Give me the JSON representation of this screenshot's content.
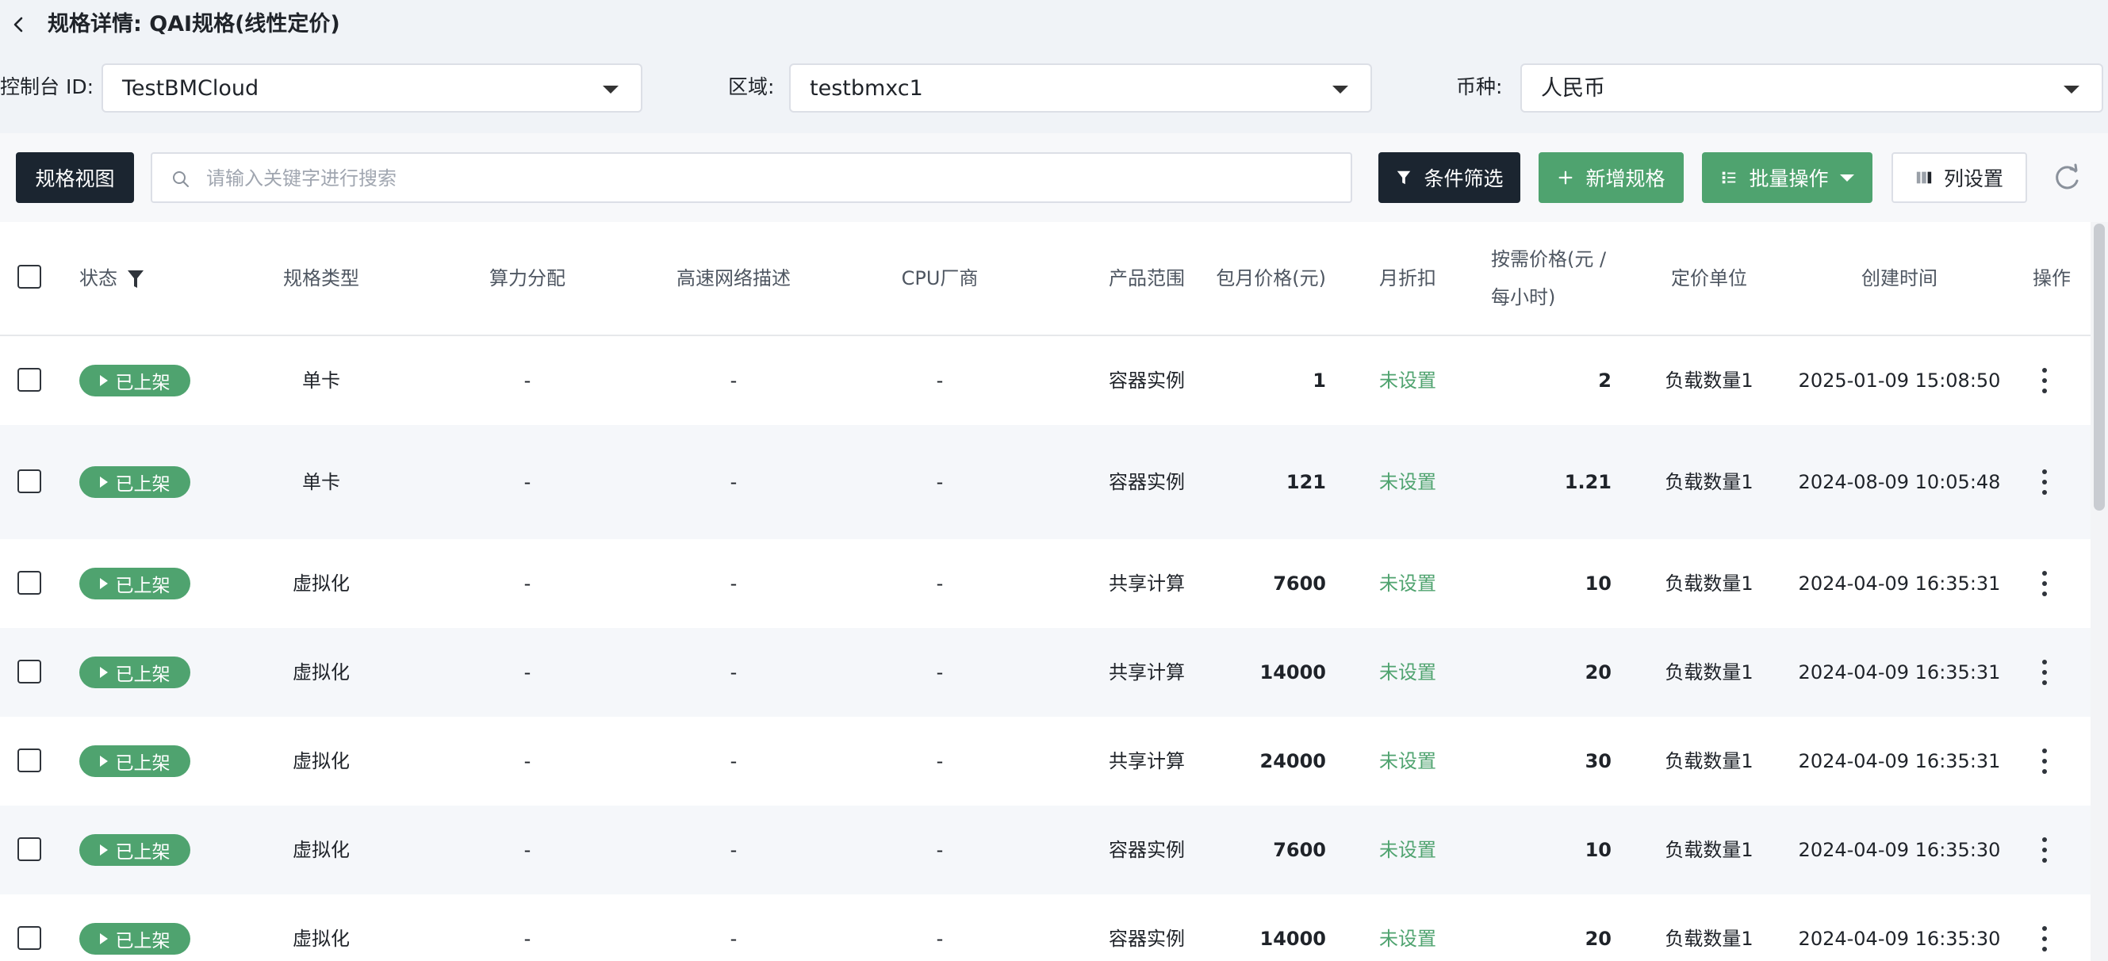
{
  "header": {
    "title": "规格详情: QAI规格(线性定价)"
  },
  "filters": {
    "console": {
      "label": "控制台 ID:",
      "value": "TestBMCloud"
    },
    "region": {
      "label": "区域:",
      "value": "testbmxc1"
    },
    "currency": {
      "label": "币种:",
      "value": "人民币"
    }
  },
  "toolbar": {
    "view_label": "规格视图",
    "search_placeholder": "请输入关键字进行搜索",
    "filter_label": "条件筛选",
    "add_label": "新增规格",
    "batch_label": "批量操作",
    "columns_label": "列设置"
  },
  "table": {
    "headers": {
      "status": "状态",
      "type": "规格类型",
      "alloc": "算力分配",
      "net": "高速网络描述",
      "cpu": "CPU厂商",
      "scope": "产品范围",
      "monthly": "包月价格(元)",
      "discount": "月折扣",
      "ondemand_1": "按需价格(元 /",
      "ondemand_2": "每小时)",
      "unit": "定价单位",
      "created": "创建时间",
      "actions": "操作"
    },
    "rows": [
      {
        "status": "已上架",
        "type": "单卡",
        "alloc": "-",
        "net": "-",
        "cpu": "-",
        "scope": "容器实例",
        "monthly": "1",
        "discount": "未设置",
        "ondemand": "2",
        "unit": "负载数量1",
        "created": "2025-01-09 15:08:50"
      },
      {
        "status": "已上架",
        "type": "单卡",
        "alloc": "-",
        "net": "-",
        "cpu": "-",
        "scope": "容器实例",
        "monthly": "121",
        "discount": "未设置",
        "ondemand": "1.21",
        "unit": "负载数量1",
        "created": "2024-08-09 10:05:48"
      },
      {
        "status": "已上架",
        "type": "虚拟化",
        "alloc": "-",
        "net": "-",
        "cpu": "-",
        "scope": "共享计算",
        "monthly": "7600",
        "discount": "未设置",
        "ondemand": "10",
        "unit": "负载数量1",
        "created": "2024-04-09 16:35:31"
      },
      {
        "status": "已上架",
        "type": "虚拟化",
        "alloc": "-",
        "net": "-",
        "cpu": "-",
        "scope": "共享计算",
        "monthly": "14000",
        "discount": "未设置",
        "ondemand": "20",
        "unit": "负载数量1",
        "created": "2024-04-09 16:35:31"
      },
      {
        "status": "已上架",
        "type": "虚拟化",
        "alloc": "-",
        "net": "-",
        "cpu": "-",
        "scope": "共享计算",
        "monthly": "24000",
        "discount": "未设置",
        "ondemand": "30",
        "unit": "负载数量1",
        "created": "2024-04-09 16:35:31"
      },
      {
        "status": "已上架",
        "type": "虚拟化",
        "alloc": "-",
        "net": "-",
        "cpu": "-",
        "scope": "容器实例",
        "monthly": "7600",
        "discount": "未设置",
        "ondemand": "10",
        "unit": "负载数量1",
        "created": "2024-04-09 16:35:30"
      },
      {
        "status": "已上架",
        "type": "虚拟化",
        "alloc": "-",
        "net": "-",
        "cpu": "-",
        "scope": "容器实例",
        "monthly": "14000",
        "discount": "未设置",
        "ondemand": "20",
        "unit": "负载数量1",
        "created": "2024-04-09 16:35:30"
      }
    ]
  },
  "colors": {
    "brand_green": "#4fa36f",
    "dark": "#1b2530",
    "page_bg": "#f0f3f7"
  }
}
